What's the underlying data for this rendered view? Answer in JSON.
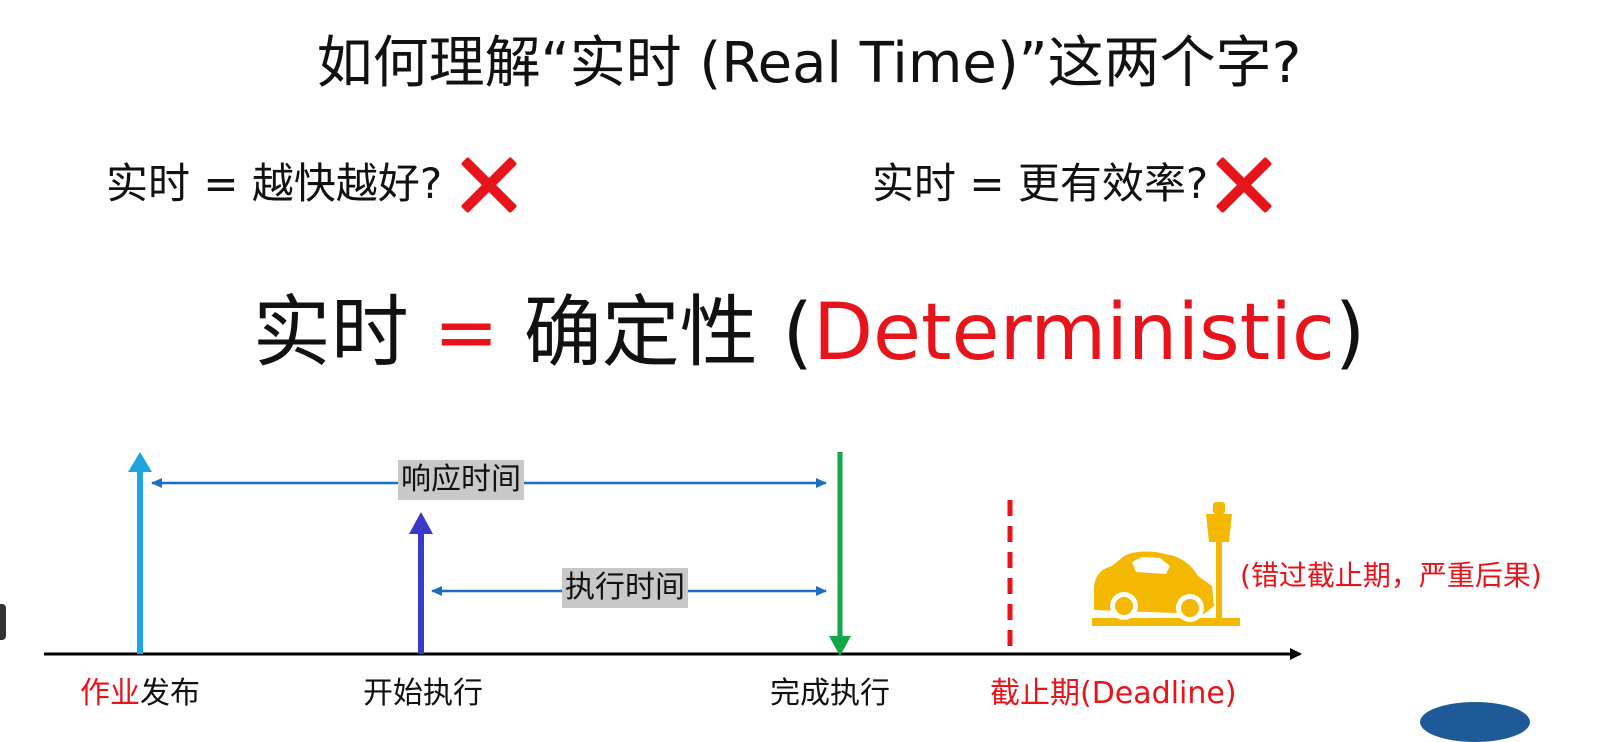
{
  "title": "如何理解“实时 (Real Time)”这两个字?",
  "claims": [
    {
      "text": "实时 = 越快越好?",
      "verdict": "wrong"
    },
    {
      "text": "实时 = 更有效率?",
      "verdict": "wrong"
    }
  ],
  "definition": {
    "lhs": "实时",
    "eq": "=",
    "rhs": "确定性",
    "paren_open": "(",
    "english": "Deterministic",
    "paren_close": ")"
  },
  "timeline": {
    "response_time_label": "响应时间",
    "execution_time_label": "执行时间",
    "events": {
      "release_red": "作业",
      "release_black": "发布",
      "start": "开始执行",
      "finish": "完成执行",
      "deadline": "截止期(Deadline)"
    },
    "consequence": "(错过截止期，严重后果)",
    "icon": "car-crash-icon"
  },
  "colors": {
    "accent_red": "#e8141b",
    "release_arrow": "#1ea5e0",
    "start_arrow": "#3a3ac8",
    "finish_arrow": "#12a84a",
    "span_arrow": "#1f6fc0",
    "car": "#f5b800"
  }
}
